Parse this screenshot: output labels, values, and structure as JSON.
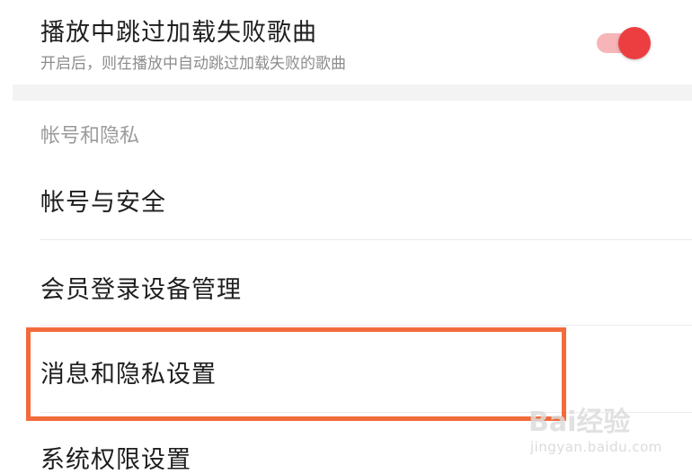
{
  "skip_failed_setting": {
    "title": "播放中跳过加载失败歌曲",
    "description": "开启后，则在播放中自动跳过加载失败的歌曲",
    "enabled": true,
    "accent_color": "#ec3e41",
    "track_color": "#f6b6b9"
  },
  "account_section": {
    "header": "帐号和隐私",
    "items": [
      {
        "label": "帐号与安全"
      },
      {
        "label": "会员登录设备管理"
      },
      {
        "label": "消息和隐私设置"
      },
      {
        "label": "系统权限设置"
      }
    ]
  },
  "highlight": {
    "color": "#f26b3c",
    "target": "消息和隐私设置"
  },
  "watermark": {
    "logo": "Bai经验",
    "url": "jingyan.baidu.com"
  }
}
